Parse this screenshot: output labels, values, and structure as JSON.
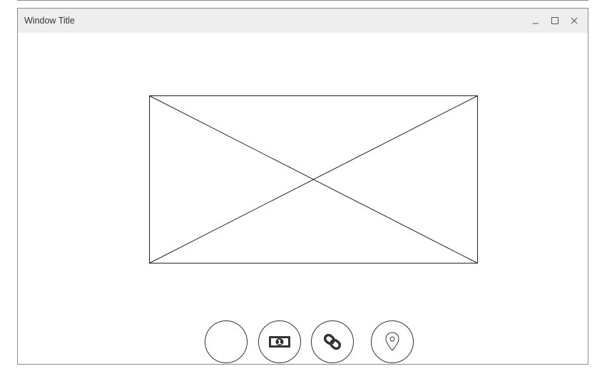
{
  "window": {
    "title": "Window Title",
    "controls": {
      "minimize_icon": "minimize-icon",
      "maximize_icon": "maximize-icon",
      "close_icon": "close-icon"
    }
  },
  "content": {
    "image_placeholder": "image-placeholder"
  },
  "action_buttons": [
    {
      "name": "blank-circle-button",
      "icon": ""
    },
    {
      "name": "money-button",
      "icon": "money-bill-icon"
    },
    {
      "name": "link-button",
      "icon": "link-icon"
    },
    {
      "name": "location-button",
      "icon": "map-pin-icon"
    }
  ],
  "colors": {
    "titlebar_bg": "#eeeeee",
    "border": "#8c8c8c",
    "stroke": "#333333"
  }
}
